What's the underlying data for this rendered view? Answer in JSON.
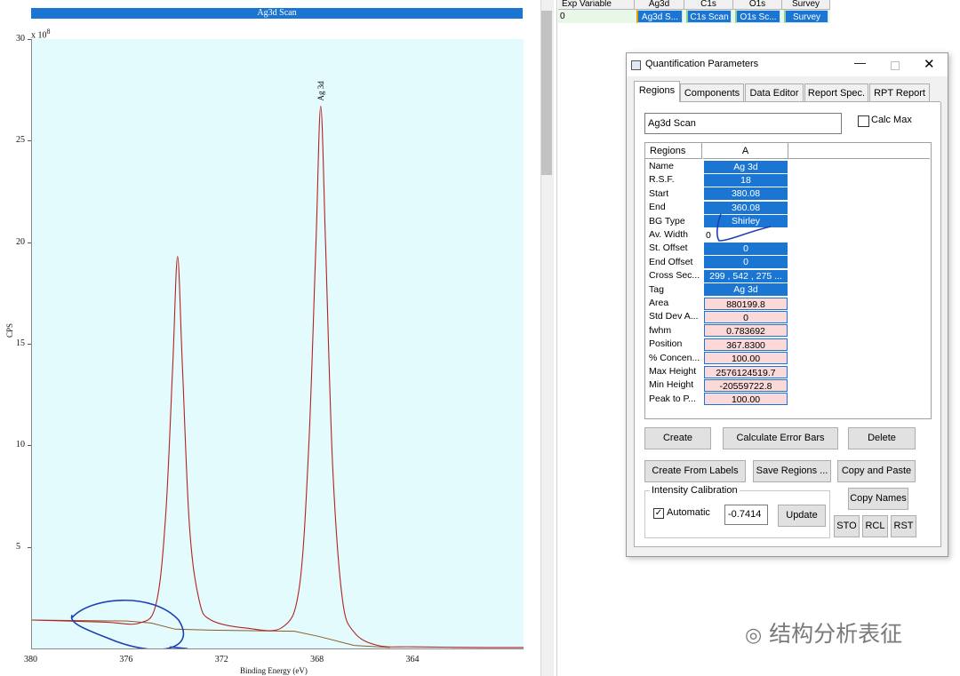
{
  "spectrum": {
    "title": "Ag3d Scan",
    "y_scale_label": "x 10",
    "y_scale_exp": "8",
    "ylabel": "CPS",
    "xlabel": "Binding Energy (eV)",
    "peak_label": "Ag 3d",
    "line_color": "#b22222",
    "bg_color": "#e4fbfd"
  },
  "chart_data": {
    "type": "line",
    "title": "Ag3d Scan",
    "xlabel": "Binding Energy (eV)",
    "ylabel": "CPS",
    "xlim": [
      380,
      359.4
    ],
    "ylim": [
      0,
      30
    ],
    "x_reversed": true,
    "xticks": [
      "380",
      "376",
      "372",
      "368",
      "364"
    ],
    "yticks": [
      "5",
      "10",
      "15",
      "20",
      "25",
      "30"
    ],
    "peaks": [
      {
        "position_ev": 373.9,
        "height": 19.3
      },
      {
        "position_ev": 367.9,
        "height": 26.7
      }
    ],
    "series": [
      {
        "name": "spectrum",
        "peak_label": "Ag 3d",
        "color": "#b22222"
      },
      {
        "name": "background",
        "color": "#8b5a2b",
        "type": "Shirley"
      }
    ],
    "spectrum_points": [
      [
        380,
        1.4
      ],
      [
        377,
        1.3
      ],
      [
        375.5,
        1.25
      ],
      [
        374.8,
        2.2
      ],
      [
        374.4,
        6.5
      ],
      [
        374.1,
        14
      ],
      [
        373.9,
        19.3
      ],
      [
        373.7,
        14
      ],
      [
        373.4,
        6
      ],
      [
        373,
        2.4
      ],
      [
        372.5,
        1.4
      ],
      [
        371,
        1.0
      ],
      [
        369.5,
        1.05
      ],
      [
        368.8,
        3.0
      ],
      [
        368.4,
        10
      ],
      [
        368.1,
        20
      ],
      [
        367.9,
        26.7
      ],
      [
        367.7,
        20
      ],
      [
        367.4,
        9
      ],
      [
        367,
        2.5
      ],
      [
        366.5,
        0.8
      ],
      [
        365.5,
        0.15
      ],
      [
        364,
        0.08
      ],
      [
        361,
        0.05
      ],
      [
        359.4,
        0.05
      ]
    ],
    "background_points": [
      [
        380,
        1.4
      ],
      [
        376,
        1.35
      ],
      [
        375,
        1.25
      ],
      [
        374,
        0.95
      ],
      [
        372.5,
        0.9
      ],
      [
        369,
        0.85
      ],
      [
        368,
        0.6
      ],
      [
        366.5,
        0.15
      ],
      [
        365,
        0.05
      ]
    ]
  },
  "grid": {
    "headers": [
      "Exp Variable",
      "Ag3d",
      "C1s",
      "O1s",
      "Survey"
    ],
    "row_index": "0",
    "cells": [
      "Ag3d S...",
      "C1s Scan",
      "O1s Sc...",
      "Survey"
    ]
  },
  "dialog": {
    "title": "Quantification Parameters",
    "tabs": [
      "Regions",
      "Components",
      "Data Editor",
      "Report Spec.",
      "RPT Report"
    ],
    "region_name": "Ag3d Scan",
    "calc_max": "Calc Max",
    "table_headers": [
      "Regions",
      "A"
    ],
    "rows": [
      {
        "label": "Name",
        "value": "Ag 3d",
        "style": "blue"
      },
      {
        "label": "R.S.F.",
        "value": "18",
        "style": "blue"
      },
      {
        "label": "Start",
        "value": "380.08",
        "style": "blue"
      },
      {
        "label": "End",
        "value": "360.08",
        "style": "blue"
      },
      {
        "label": "BG Type",
        "value": "Shirley",
        "style": "blue"
      },
      {
        "label": "Av. Width",
        "value": "0",
        "style": "plain"
      },
      {
        "label": "St. Offset",
        "value": "0",
        "style": "blue"
      },
      {
        "label": "End Offset",
        "value": "0",
        "style": "blue"
      },
      {
        "label": "Cross Sec...",
        "value": "299 , 542 , 275 ...",
        "style": "blue"
      },
      {
        "label": "Tag",
        "value": "Ag 3d",
        "style": "blue"
      },
      {
        "label": "Area",
        "value": "880199.8",
        "style": "pink"
      },
      {
        "label": "Std Dev A...",
        "value": "0",
        "style": "pink"
      },
      {
        "label": "fwhm",
        "value": "0.783692",
        "style": "pink"
      },
      {
        "label": "Position",
        "value": "367.8300",
        "style": "pink"
      },
      {
        "label": "% Concen...",
        "value": "100.00",
        "style": "pink"
      },
      {
        "label": "Max Height",
        "value": "2576124519.7",
        "style": "pink"
      },
      {
        "label": "Min Height",
        "value": "-20559722.8",
        "style": "pink"
      },
      {
        "label": "Peak to P...",
        "value": "100.00",
        "style": "pink"
      }
    ],
    "buttons": {
      "create": "Create",
      "calc_error_bars": "Calculate Error Bars",
      "delete": "Delete",
      "create_from_labels": "Create From Labels",
      "save_regions": "Save Regions ...",
      "copy_and_paste": "Copy and Paste",
      "copy_names": "Copy Names",
      "update": "Update",
      "sto": "STO",
      "rcl": "RCL",
      "rst": "RST"
    },
    "intensity_group": "Intensity Calibration",
    "automatic": "Automatic",
    "calibration_value": "-0.7414"
  },
  "watermark": "结构分析表征"
}
